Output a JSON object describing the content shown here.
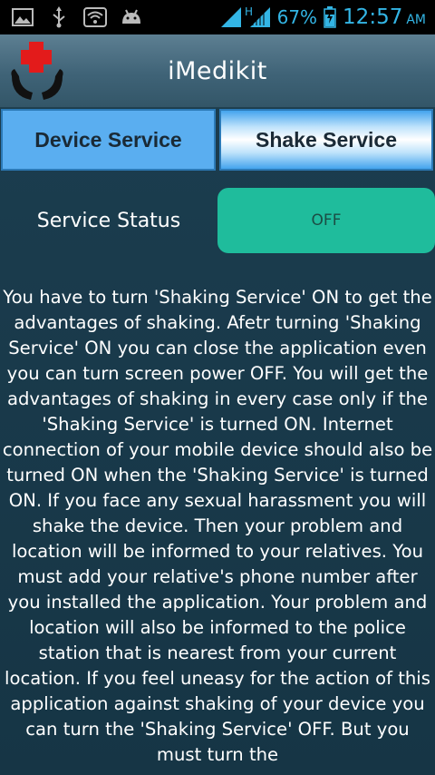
{
  "status_bar": {
    "battery_percent": "67%",
    "time": "12:57",
    "ampm": "AM",
    "signal_type": "H",
    "icons": [
      "image-icon",
      "usb-icon",
      "wifi-icon",
      "android-icon",
      "signal-icon",
      "battery-icon"
    ],
    "accent_color": "#33b5e5"
  },
  "app_bar": {
    "title": "iMedikit",
    "logo": "medical-cross-hands-logo"
  },
  "tabs": [
    {
      "label": "Device Service",
      "selected": true
    },
    {
      "label": "Shake Service",
      "selected": false
    }
  ],
  "service": {
    "label": "Service Status",
    "toggle_value": "OFF",
    "toggle_color": "#1fbc9c"
  },
  "description": "You have to turn 'Shaking Service' ON to get the advantages of shaking. Afetr turning 'Shaking Service' ON you can close the application even you can turn screen power OFF. You will get the advantages of shaking in every case only if the 'Shaking Service' is turned ON. Internet connection of your mobile device should also be turned ON when the 'Shaking Service' is turned ON. If you face any sexual harassment you will shake the device. Then your problem and location will be informed to your relatives. You must add your relative's phone number after you installed the application. Your problem and location will also be informed to the police station that is nearest from your current location. If you feel uneasy for the action of this application against shaking of your device you can turn the 'Shaking Service' OFF. But you must turn the"
}
